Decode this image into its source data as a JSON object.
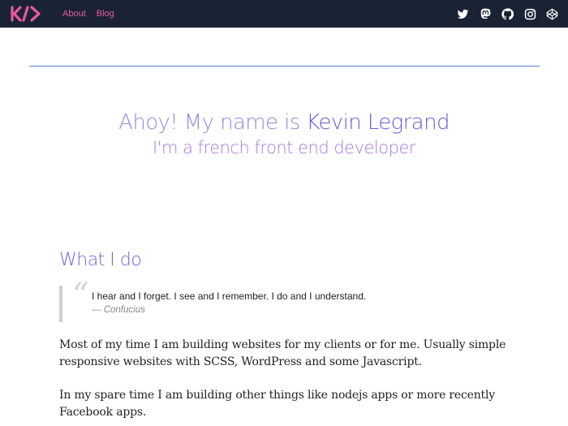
{
  "nav": {
    "logo_alt": "KL logo",
    "links": [
      {
        "label": "About"
      },
      {
        "label": "Blog"
      }
    ],
    "social": [
      {
        "icon": "twitter-icon"
      },
      {
        "icon": "mastodon-icon"
      },
      {
        "icon": "github-icon"
      },
      {
        "icon": "instagram-icon"
      },
      {
        "icon": "codepen-icon"
      }
    ]
  },
  "colors": {
    "navbar_bg": "#1a2333",
    "accent_pink": "#e85a9f",
    "rule_blue": "#5b7fdf",
    "heading_purple": "#6c68db"
  },
  "hero": {
    "greeting": "Ahoy! My name is ",
    "name": "Kevin Legrand",
    "tagline": "I'm a french front end developer"
  },
  "what_i_do": {
    "title": "What I do",
    "quote": {
      "mark": "“",
      "text": "I hear and I forget. I see and I remember. I do and I understand.",
      "author": "— Confucius"
    },
    "paragraphs": [
      "Most of my time I am building websites for my clients or for me. Usually simple responsive websites with SCSS, WordPress and some Javascript.",
      "In my spare time I am building other things like nodejs apps or more recently Facebook apps."
    ]
  }
}
